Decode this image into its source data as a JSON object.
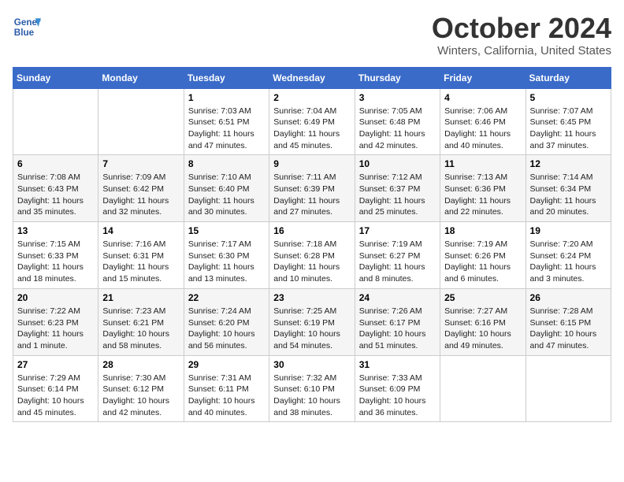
{
  "header": {
    "logo_line1": "General",
    "logo_line2": "Blue",
    "title": "October 2024",
    "location": "Winters, California, United States"
  },
  "days_of_week": [
    "Sunday",
    "Monday",
    "Tuesday",
    "Wednesday",
    "Thursday",
    "Friday",
    "Saturday"
  ],
  "weeks": [
    [
      {
        "day": "",
        "info": ""
      },
      {
        "day": "",
        "info": ""
      },
      {
        "day": "1",
        "info": "Sunrise: 7:03 AM\nSunset: 6:51 PM\nDaylight: 11 hours and 47 minutes."
      },
      {
        "day": "2",
        "info": "Sunrise: 7:04 AM\nSunset: 6:49 PM\nDaylight: 11 hours and 45 minutes."
      },
      {
        "day": "3",
        "info": "Sunrise: 7:05 AM\nSunset: 6:48 PM\nDaylight: 11 hours and 42 minutes."
      },
      {
        "day": "4",
        "info": "Sunrise: 7:06 AM\nSunset: 6:46 PM\nDaylight: 11 hours and 40 minutes."
      },
      {
        "day": "5",
        "info": "Sunrise: 7:07 AM\nSunset: 6:45 PM\nDaylight: 11 hours and 37 minutes."
      }
    ],
    [
      {
        "day": "6",
        "info": "Sunrise: 7:08 AM\nSunset: 6:43 PM\nDaylight: 11 hours and 35 minutes."
      },
      {
        "day": "7",
        "info": "Sunrise: 7:09 AM\nSunset: 6:42 PM\nDaylight: 11 hours and 32 minutes."
      },
      {
        "day": "8",
        "info": "Sunrise: 7:10 AM\nSunset: 6:40 PM\nDaylight: 11 hours and 30 minutes."
      },
      {
        "day": "9",
        "info": "Sunrise: 7:11 AM\nSunset: 6:39 PM\nDaylight: 11 hours and 27 minutes."
      },
      {
        "day": "10",
        "info": "Sunrise: 7:12 AM\nSunset: 6:37 PM\nDaylight: 11 hours and 25 minutes."
      },
      {
        "day": "11",
        "info": "Sunrise: 7:13 AM\nSunset: 6:36 PM\nDaylight: 11 hours and 22 minutes."
      },
      {
        "day": "12",
        "info": "Sunrise: 7:14 AM\nSunset: 6:34 PM\nDaylight: 11 hours and 20 minutes."
      }
    ],
    [
      {
        "day": "13",
        "info": "Sunrise: 7:15 AM\nSunset: 6:33 PM\nDaylight: 11 hours and 18 minutes."
      },
      {
        "day": "14",
        "info": "Sunrise: 7:16 AM\nSunset: 6:31 PM\nDaylight: 11 hours and 15 minutes."
      },
      {
        "day": "15",
        "info": "Sunrise: 7:17 AM\nSunset: 6:30 PM\nDaylight: 11 hours and 13 minutes."
      },
      {
        "day": "16",
        "info": "Sunrise: 7:18 AM\nSunset: 6:28 PM\nDaylight: 11 hours and 10 minutes."
      },
      {
        "day": "17",
        "info": "Sunrise: 7:19 AM\nSunset: 6:27 PM\nDaylight: 11 hours and 8 minutes."
      },
      {
        "day": "18",
        "info": "Sunrise: 7:19 AM\nSunset: 6:26 PM\nDaylight: 11 hours and 6 minutes."
      },
      {
        "day": "19",
        "info": "Sunrise: 7:20 AM\nSunset: 6:24 PM\nDaylight: 11 hours and 3 minutes."
      }
    ],
    [
      {
        "day": "20",
        "info": "Sunrise: 7:22 AM\nSunset: 6:23 PM\nDaylight: 11 hours and 1 minute."
      },
      {
        "day": "21",
        "info": "Sunrise: 7:23 AM\nSunset: 6:21 PM\nDaylight: 10 hours and 58 minutes."
      },
      {
        "day": "22",
        "info": "Sunrise: 7:24 AM\nSunset: 6:20 PM\nDaylight: 10 hours and 56 minutes."
      },
      {
        "day": "23",
        "info": "Sunrise: 7:25 AM\nSunset: 6:19 PM\nDaylight: 10 hours and 54 minutes."
      },
      {
        "day": "24",
        "info": "Sunrise: 7:26 AM\nSunset: 6:17 PM\nDaylight: 10 hours and 51 minutes."
      },
      {
        "day": "25",
        "info": "Sunrise: 7:27 AM\nSunset: 6:16 PM\nDaylight: 10 hours and 49 minutes."
      },
      {
        "day": "26",
        "info": "Sunrise: 7:28 AM\nSunset: 6:15 PM\nDaylight: 10 hours and 47 minutes."
      }
    ],
    [
      {
        "day": "27",
        "info": "Sunrise: 7:29 AM\nSunset: 6:14 PM\nDaylight: 10 hours and 45 minutes."
      },
      {
        "day": "28",
        "info": "Sunrise: 7:30 AM\nSunset: 6:12 PM\nDaylight: 10 hours and 42 minutes."
      },
      {
        "day": "29",
        "info": "Sunrise: 7:31 AM\nSunset: 6:11 PM\nDaylight: 10 hours and 40 minutes."
      },
      {
        "day": "30",
        "info": "Sunrise: 7:32 AM\nSunset: 6:10 PM\nDaylight: 10 hours and 38 minutes."
      },
      {
        "day": "31",
        "info": "Sunrise: 7:33 AM\nSunset: 6:09 PM\nDaylight: 10 hours and 36 minutes."
      },
      {
        "day": "",
        "info": ""
      },
      {
        "day": "",
        "info": ""
      }
    ]
  ]
}
